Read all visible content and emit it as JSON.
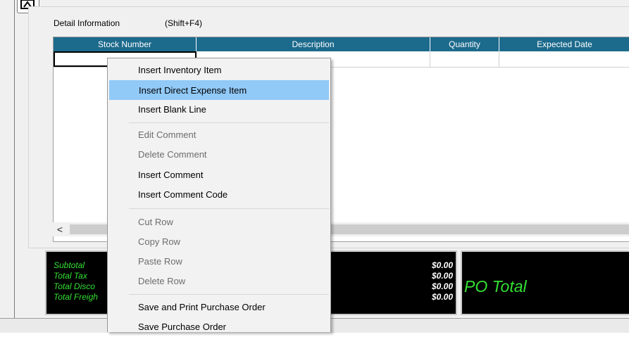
{
  "detail": {
    "title": "Detail Information",
    "shortcut": "(Shift+F4)"
  },
  "grid": {
    "columns": [
      "Stock Number",
      "Description",
      "Quantity",
      "Expected Date"
    ]
  },
  "scrollbar": {
    "left_arrow": "<"
  },
  "totals": {
    "labels": [
      "Subtotal",
      "Total Tax",
      "Total Disco",
      "Total Freigh"
    ],
    "values": [
      "$0.00",
      "$0.00",
      "$0.00",
      "$0.00"
    ],
    "po_total_label": "PO Total"
  },
  "context_menu": {
    "items": [
      {
        "label": "Insert Inventory Item",
        "enabled": true
      },
      {
        "label": "Insert Direct Expense Item",
        "enabled": true,
        "highlighted": true
      },
      {
        "label": "Insert Blank Line",
        "enabled": true
      },
      {
        "label": "Edit Comment",
        "enabled": false
      },
      {
        "label": "Delete Comment",
        "enabled": false
      },
      {
        "label": "Insert Comment",
        "enabled": true
      },
      {
        "label": "Insert Comment Code",
        "enabled": true
      },
      {
        "label": "Cut Row",
        "enabled": false
      },
      {
        "label": "Copy Row",
        "enabled": false
      },
      {
        "label": "Paste Row",
        "enabled": false
      },
      {
        "label": "Delete Row",
        "enabled": false
      },
      {
        "label": "Save and Print Purchase Order",
        "enabled": true
      },
      {
        "label": "Save Purchase Order",
        "enabled": true
      }
    ]
  },
  "colors": {
    "grid_header": "#1c6a8c",
    "totals_label": "#34e034",
    "menu_highlight": "#91c9f7"
  }
}
